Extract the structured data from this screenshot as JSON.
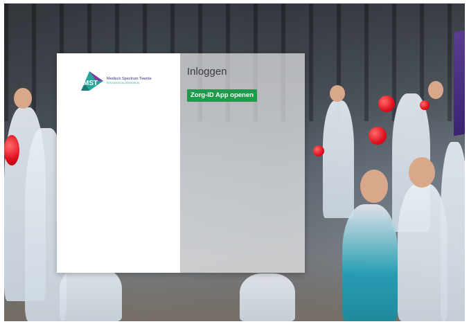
{
  "login": {
    "title": "Inloggen",
    "zorgid_button_label": "Zorg-ID App openen"
  },
  "logo": {
    "mark_text": "MST",
    "name": "Medisch Spectrum Twente",
    "tagline": "EEN SANTEON ZIEKENHUIS"
  },
  "colors": {
    "button_green": "#1f9a4a",
    "logo_teal": "#26a69a",
    "logo_navy": "#2b2b6b"
  }
}
